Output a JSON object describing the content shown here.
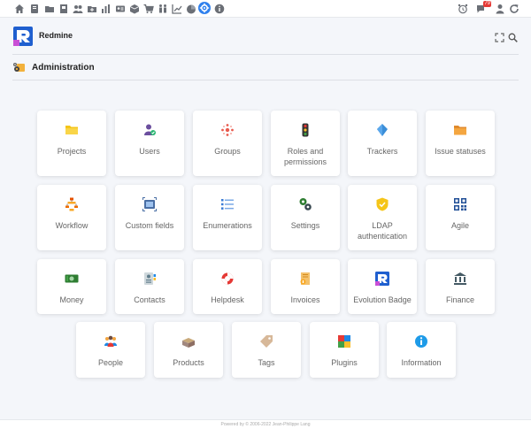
{
  "topbar": {
    "icons": [
      "home-icon",
      "journal-icon",
      "folder-icon",
      "book-icon",
      "users-group-icon",
      "folder-add-icon",
      "chart-icon",
      "contacts-card-icon",
      "box-icon",
      "cart-icon",
      "people-icon",
      "chart-up-icon",
      "pie-chart-icon",
      "gear-icon",
      "info-icon"
    ],
    "right_icons": [
      "alarm-clock-icon",
      "notifications-icon",
      "user-icon",
      "refresh-icon"
    ],
    "notification_count": "79"
  },
  "header": {
    "app_name": "Redmine"
  },
  "page": {
    "title": "Administration"
  },
  "tiles": [
    {
      "label": "Projects",
      "icon": "folder-icon"
    },
    {
      "label": "Users",
      "icon": "user-check-icon"
    },
    {
      "label": "Groups",
      "icon": "groups-icon"
    },
    {
      "label": "Roles and permissions",
      "icon": "traffic-light-icon"
    },
    {
      "label": "Trackers",
      "icon": "tracker-icon"
    },
    {
      "label": "Issue statuses",
      "icon": "folder-status-icon"
    },
    {
      "label": "Workflow",
      "icon": "workflow-icon"
    },
    {
      "label": "Custom fields",
      "icon": "custom-fields-icon"
    },
    {
      "label": "Enumerations",
      "icon": "list-icon"
    },
    {
      "label": "Settings",
      "icon": "settings-gears-icon"
    },
    {
      "label": "LDAP authentication",
      "icon": "shield-icon"
    },
    {
      "label": "Agile",
      "icon": "qr-icon"
    },
    {
      "label": "Money",
      "icon": "money-icon"
    },
    {
      "label": "Contacts",
      "icon": "contacts-icon"
    },
    {
      "label": "Helpdesk",
      "icon": "lifebuoy-icon"
    },
    {
      "label": "Invoices",
      "icon": "invoice-icon"
    },
    {
      "label": "Evolution Badge",
      "icon": "badge-logo-icon"
    },
    {
      "label": "Finance",
      "icon": "finance-icon"
    },
    {
      "label": "People",
      "icon": "people-icon"
    },
    {
      "label": "Products",
      "icon": "products-icon"
    },
    {
      "label": "Tags",
      "icon": "tag-icon"
    },
    {
      "label": "Plugins",
      "icon": "plugin-icon"
    },
    {
      "label": "Information",
      "icon": "info-icon"
    }
  ],
  "footer": {
    "text": "Powered by © 2006-2022 Jean-Philippe Lang"
  }
}
